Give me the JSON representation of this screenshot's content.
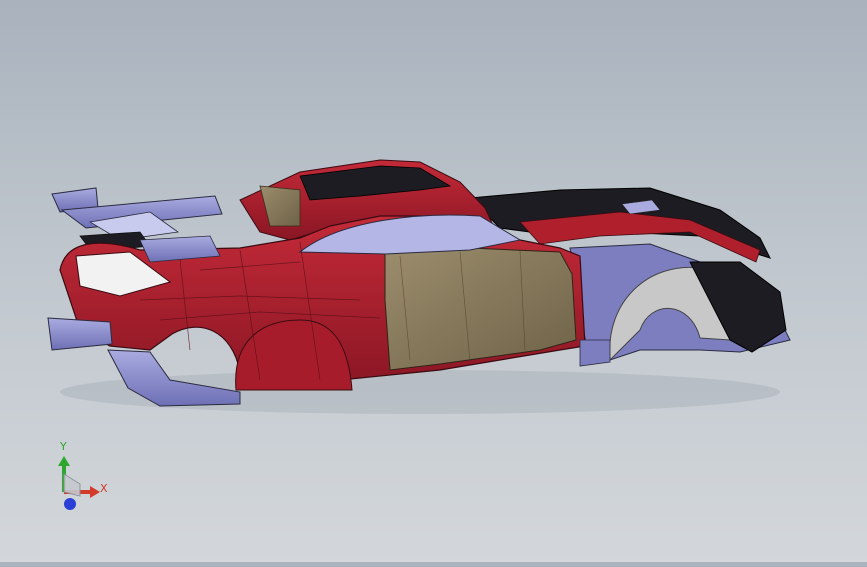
{
  "viewport": {
    "model": "car-body-wireframe-model"
  },
  "triad": {
    "x_label": "X",
    "y_label": "Y",
    "colors": {
      "x": "#d23a2a",
      "y": "#2fa62f",
      "z": "#2a3fd6"
    }
  },
  "colors": {
    "body_red": "#b01f2c",
    "body_red_dark": "#7d1420",
    "interior_khaki": "#8b7c5e",
    "panel_lavender": "#8a8ccf",
    "carbon_black": "#1c1c22",
    "edge_line": "#3a0b12"
  }
}
